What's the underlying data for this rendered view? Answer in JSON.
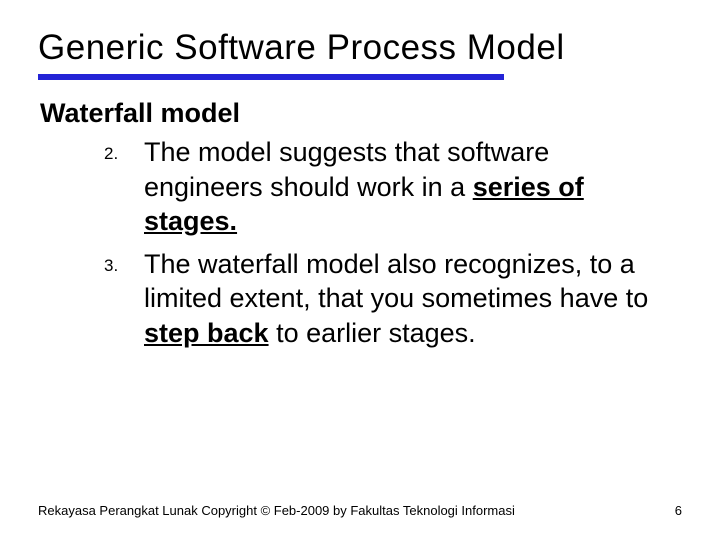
{
  "title": "Generic Software Process Model",
  "subtitle": "Waterfall model",
  "items": [
    {
      "num": "2.",
      "pre": "The model suggests that software engineers should work in a ",
      "emph": "series of stages.",
      "post": ""
    },
    {
      "num": "3.",
      "pre": "The waterfall model also recognizes, to a limited extent, that you sometimes have to ",
      "emph": "step back",
      "post": " to earlier stages."
    }
  ],
  "footer": {
    "copyright": "Rekayasa Perangkat Lunak Copyright © Feb-2009 by Fakultas Teknologi Informasi",
    "page": "6"
  }
}
